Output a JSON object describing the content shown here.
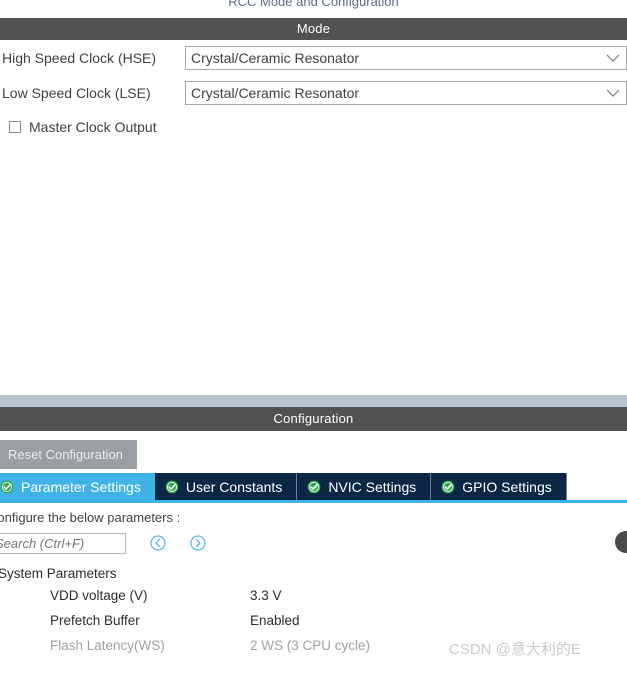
{
  "window": {
    "title": "RCC Mode and Configuration"
  },
  "mode": {
    "header": "Mode",
    "rows": [
      {
        "label": "High Speed Clock (HSE)",
        "value": "Crystal/Ceramic Resonator",
        "icon": "chevron-down-icon"
      },
      {
        "label": "Low Speed Clock (LSE)",
        "value": "Crystal/Ceramic Resonator",
        "icon": "chevron-down-icon"
      }
    ],
    "checkbox": {
      "label": "Master Clock Output",
      "checked": false
    }
  },
  "configuration": {
    "header": "Configuration",
    "reset_label": "Reset Configuration",
    "tabs": [
      {
        "label": "Parameter Settings",
        "active": true,
        "icon": "check-circle-icon"
      },
      {
        "label": "User Constants",
        "active": false,
        "icon": "check-circle-icon"
      },
      {
        "label": "NVIC Settings",
        "active": false,
        "icon": "check-circle-icon"
      },
      {
        "label": "GPIO Settings",
        "active": false,
        "icon": "check-circle-icon"
      }
    ],
    "note": "Configure the below parameters :",
    "search": {
      "placeholder": "Search (Ctrl+F)",
      "value": ""
    },
    "nav": {
      "prev_icon": "chevron-left-circle-icon",
      "next_icon": "chevron-right-circle-icon"
    },
    "params": {
      "group": "System Parameters",
      "rows": [
        {
          "name": "VDD voltage (V)",
          "value": "3.3 V",
          "clipped": false
        },
        {
          "name": "Prefetch Buffer",
          "value": "Enabled",
          "clipped": false
        },
        {
          "name": "Flash Latency(WS)",
          "value": "2 WS (3 CPU cycle)",
          "clipped": true
        }
      ]
    }
  },
  "watermark": {
    "text": "CSDN @意大利的E"
  },
  "colors": {
    "panel_header_bg": "#4f5152",
    "separator_band": "#b9c4ce",
    "tab_active_bg": "#3fb3e6",
    "tab_inactive_bg": "#0c2746",
    "check_icon_green": "#2fa84f",
    "nav_icon_blue": "#4fb6e8",
    "reset_btn_bg": "#9a9fa3"
  }
}
